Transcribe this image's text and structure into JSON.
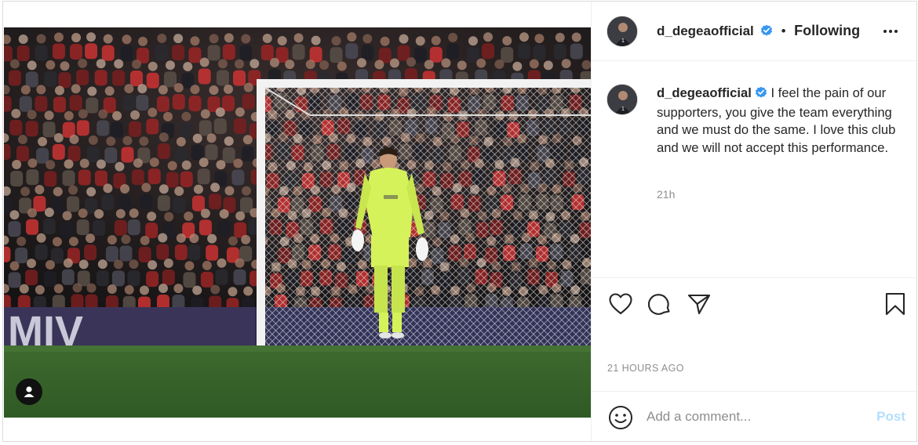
{
  "post": {
    "author": {
      "username": "d_degeaofficial",
      "verified": true,
      "follow_status": "Following",
      "separator": "•"
    },
    "caption": {
      "username": "d_degeaofficial",
      "text": "I feel the pain of our supporters, you give the team everything and we must do the same. I love this club and we will not accept this performance.",
      "time_short": "21h"
    },
    "timestamp": "21 HOURS AGO",
    "comment": {
      "placeholder": "Add a comment...",
      "post_label": "Post"
    },
    "icons": {
      "more": "more-options-icon",
      "like": "heart-icon",
      "comment": "comment-icon",
      "share": "paper-plane-icon",
      "save": "bookmark-icon",
      "emoji": "emoji-icon",
      "tagged": "user-tag-icon",
      "verified": "verified-badge-icon"
    },
    "colors": {
      "verified": "#3897f0",
      "post_disabled": "#b2dffc",
      "meta_gray": "#8e8e8e",
      "keeper_kit": "#d6f25a"
    }
  }
}
